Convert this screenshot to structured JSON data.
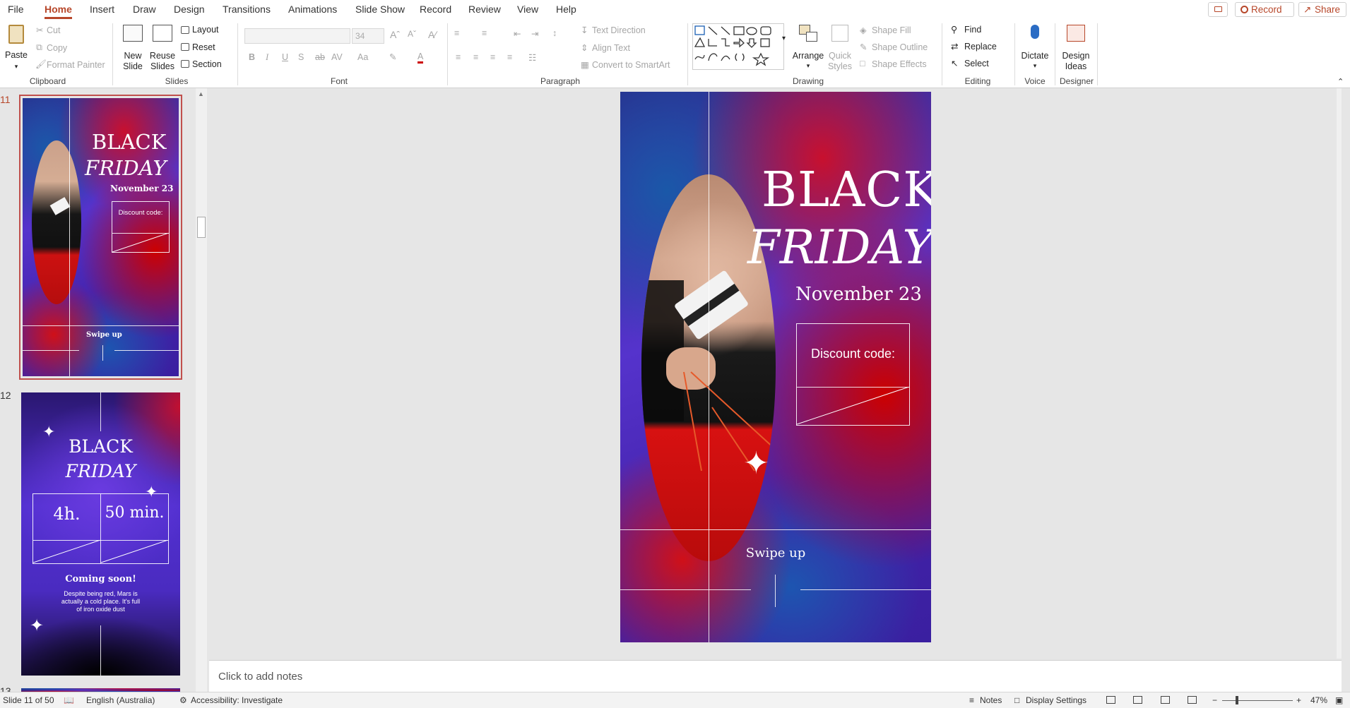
{
  "tabs": [
    "File",
    "Home",
    "Insert",
    "Draw",
    "Design",
    "Transitions",
    "Animations",
    "Slide Show",
    "Record",
    "Review",
    "View",
    "Help"
  ],
  "header_buttons": {
    "record": "Record",
    "share": "Share"
  },
  "ribbon": {
    "clipboard": {
      "paste": "Paste",
      "cut": "Cut",
      "copy": "Copy",
      "format_painter": "Format Painter",
      "label": "Clipboard"
    },
    "slides": {
      "new_slide": "New Slide",
      "new_slide_l1": "New",
      "new_slide_l2": "Slide",
      "reuse_l1": "Reuse",
      "reuse_l2": "Slides",
      "layout": "Layout",
      "reset": "Reset",
      "section": "Section",
      "label": "Slides"
    },
    "font": {
      "size": "34",
      "label": "Font"
    },
    "paragraph": {
      "text_direction": "Text Direction",
      "align_text": "Align Text",
      "convert_smartart": "Convert to SmartArt",
      "label": "Paragraph"
    },
    "drawing": {
      "arrange": "Arrange",
      "quick_l1": "Quick",
      "quick_l2": "Styles",
      "shape_fill": "Shape Fill",
      "shape_outline": "Shape Outline",
      "shape_effects": "Shape Effects",
      "label": "Drawing"
    },
    "editing": {
      "find": "Find",
      "replace": "Replace",
      "select": "Select",
      "label": "Editing"
    },
    "voice": {
      "dictate": "Dictate",
      "label": "Voice"
    },
    "designer": {
      "design_l1": "Design",
      "design_l2": "Ideas",
      "label": "Designer"
    }
  },
  "thumbnails": [
    {
      "number": "11",
      "title1": "BLACK",
      "title2": "FRIDAY",
      "date": "November 23",
      "discount": "Discount code:",
      "swipe": "Swipe up"
    },
    {
      "number": "12",
      "title1": "BLACK",
      "title2": "FRIDAY",
      "hours": "4h.",
      "minutes": "50 min.",
      "coming": "Coming soon!",
      "body": "Despite being red, Mars is actually a cold place. It's full of iron oxide dust"
    },
    {
      "number": "13"
    }
  ],
  "slide": {
    "title1": "BLACK",
    "title2": "FRIDAY",
    "date": "November 23",
    "discount": "Discount code:",
    "swipe": "Swipe up"
  },
  "notes_placeholder": "Click to add notes",
  "status": {
    "slide": "Slide 11 of 50",
    "language": "English (Australia)",
    "accessibility": "Accessibility: Investigate",
    "notes": "Notes",
    "display": "Display Settings",
    "zoom": "47%"
  },
  "colors": {
    "accent": "#b7472a",
    "ribbon": "#ffffff",
    "canvas": "#e6e6e6"
  }
}
